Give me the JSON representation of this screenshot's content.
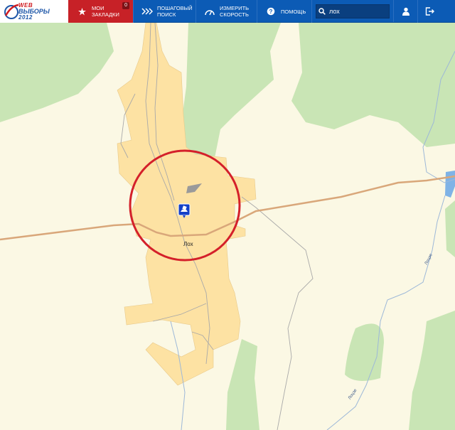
{
  "app": {
    "logo_line1": "WEB",
    "logo_line2": "ВЫБОРЫ",
    "logo_line3": "2012"
  },
  "nav": {
    "bookmarks": {
      "line1": "МОИ",
      "line2": "ЗАКЛАДКИ",
      "badge": "0",
      "icon": "star-icon"
    },
    "step_search": {
      "line1": "ПОШАГОВЫЙ",
      "line2": "ПОИСК",
      "icon": "steps-icon"
    },
    "speed_test": {
      "line1": "ИЗМЕРИТЬ",
      "line2": "СКОРОСТЬ",
      "icon": "speedometer-icon"
    },
    "help": {
      "label": "ПОМОЩЬ",
      "icon": "help-icon"
    }
  },
  "search": {
    "value": "лох",
    "icon": "search-icon"
  },
  "actions": {
    "user_icon": "user-icon",
    "logout_icon": "logout-icon"
  },
  "map": {
    "town_name": "Лох",
    "creek_label_1": "Лоцзе",
    "creek_label_2": "Лоцзе",
    "marker_icon": "polling-station-icon",
    "colors": {
      "background": "#fbf8e4",
      "forest": "#c9e5b5",
      "settlement": "#fde2a3",
      "road": "#d9a77a",
      "water": "#7fb3e6",
      "highlight_circle": "#d4202a"
    }
  }
}
